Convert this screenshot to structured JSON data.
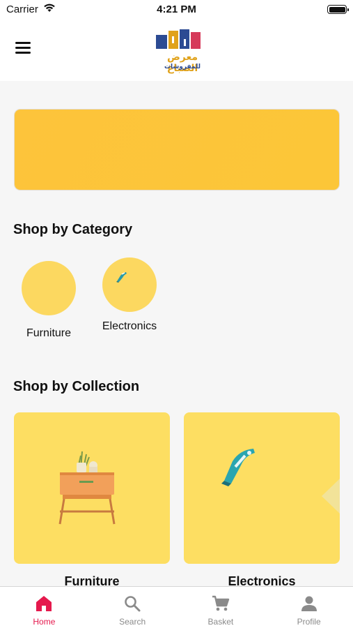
{
  "status_bar": {
    "carrier": "Carrier",
    "time": "4:21 PM"
  },
  "header": {
    "logo_text_line1": "معرض الصباغ",
    "logo_text_line2": "للمفروشات"
  },
  "sections": {
    "category_title": "Shop by Category",
    "collection_title": "Shop by Collection"
  },
  "categories": [
    {
      "label": "Furniture",
      "icon": "empty"
    },
    {
      "label": "Electronics",
      "icon": "iron-icon"
    }
  ],
  "collections": [
    {
      "label": "Furniture",
      "icon": "nightstand-icon"
    },
    {
      "label": "Electronics",
      "icon": "iron-icon"
    }
  ],
  "tab_bar": {
    "tabs": [
      {
        "label": "Home",
        "icon": "home-icon",
        "active": true
      },
      {
        "label": "Search",
        "icon": "search-icon",
        "active": false
      },
      {
        "label": "Basket",
        "icon": "cart-icon",
        "active": false
      },
      {
        "label": "Profile",
        "icon": "person-icon",
        "active": false
      }
    ]
  },
  "colors": {
    "accent": "#e5194d",
    "banner": "#fdc43b",
    "card": "#fdde62",
    "circle": "#fcd860",
    "inactive_tab": "#8a8a8a"
  }
}
